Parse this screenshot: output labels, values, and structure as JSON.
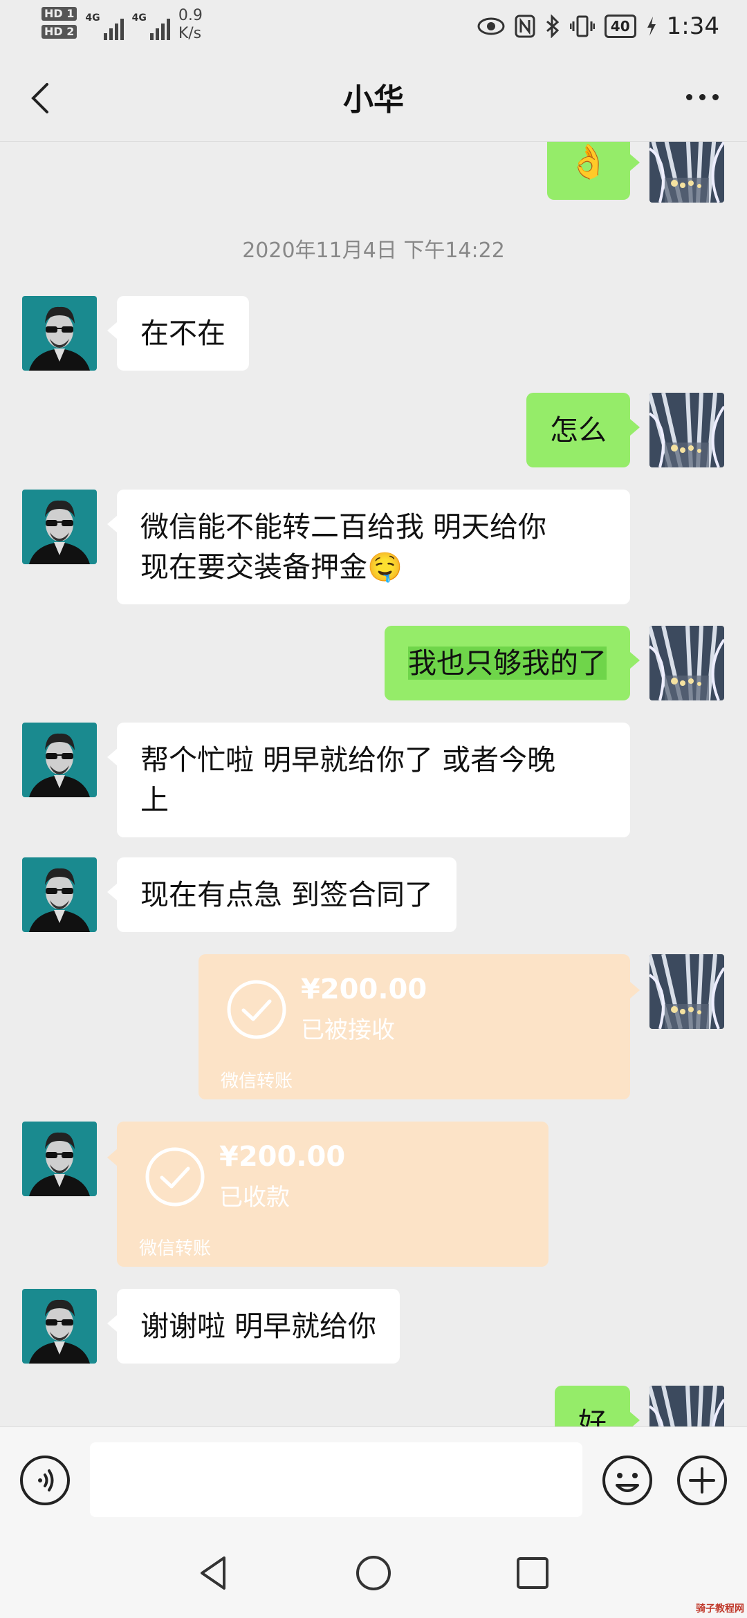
{
  "status_bar": {
    "hd1": "HD 1",
    "hd2": "HD 2",
    "net1": "4G",
    "net2": "4G",
    "speed_value": "0.9",
    "speed_unit": "K/s",
    "battery": "40",
    "time": "1:34"
  },
  "header": {
    "title": "小华",
    "back_icon": "chevron-left-icon",
    "more_icon": "more-horizontal-icon"
  },
  "chat": {
    "timestamp": "2020年11月4日 下午14:22",
    "messages": [
      {
        "from": "me",
        "type": "emoji",
        "text": "👌"
      },
      {
        "from": "contact",
        "type": "text",
        "text": "在不在"
      },
      {
        "from": "me",
        "type": "text",
        "text": "怎么"
      },
      {
        "from": "contact",
        "type": "text",
        "text": "微信能不能转二百给我 明天给你",
        "text2": "现在要交装备押金🤤"
      },
      {
        "from": "me",
        "type": "text",
        "text": "我也只够我的了"
      },
      {
        "from": "contact",
        "type": "text",
        "text": "帮个忙啦 明早就给你了 或者今晚",
        "text2": "上"
      },
      {
        "from": "contact",
        "type": "text",
        "text": "现在有点急 到签合同了"
      },
      {
        "from": "me",
        "type": "transfer",
        "amount": "¥200.00",
        "status": "已被接收",
        "footer": "微信转账"
      },
      {
        "from": "contact",
        "type": "transfer",
        "amount": "¥200.00",
        "status": "已收款",
        "footer": "微信转账"
      },
      {
        "from": "contact",
        "type": "text",
        "text": "谢谢啦 明早就给你"
      },
      {
        "from": "me",
        "type": "text",
        "text": "好"
      }
    ]
  },
  "input_bar": {
    "voice_icon": "voice-icon",
    "emoji_icon": "emoji-icon",
    "plus_icon": "plus-icon",
    "placeholder": ""
  },
  "system_nav": {
    "back_icon": "triangle-back-icon",
    "home_icon": "circle-home-icon",
    "recents_icon": "square-recents-icon"
  },
  "colors": {
    "background": "#ededed",
    "outgoing_bubble": "#95ec69",
    "incoming_bubble": "#ffffff",
    "transfer_bubble": "#fce3c7",
    "avatar_teal": "#1a8a8f"
  },
  "watermark": "骑子教程网"
}
